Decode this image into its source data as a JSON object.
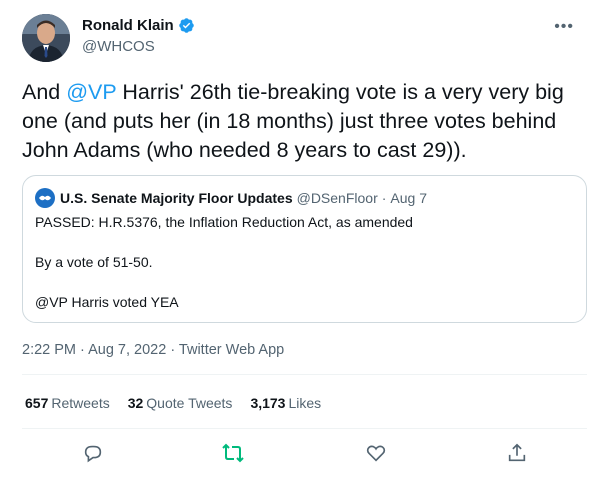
{
  "author": {
    "name": "Ronald Klain",
    "handle": "@WHCOS",
    "verified": true
  },
  "tweet": {
    "text_before": "And ",
    "mention": "@VP",
    "text_after": " Harris' 26th tie-breaking vote is a very very big one (and puts her (in 18 months) just three votes behind John Adams (who needed 8 years to cast 29)).",
    "timestamp": "2:22 PM · Aug 7, 2022 · Twitter Web App"
  },
  "quote": {
    "name": "U.S. Senate Majority Floor Updates",
    "handle": "@DSenFloor",
    "separator": "·",
    "date": "Aug 7",
    "lines": [
      "PASSED: H.R.5376, the Inflation Reduction Act, as amended",
      "By a vote of 51-50.",
      "@VP Harris voted YEA"
    ]
  },
  "stats": {
    "retweets_count": "657",
    "retweets_label": "Retweets",
    "quotes_count": "32",
    "quotes_label": "Quote Tweets",
    "likes_count": "3,173",
    "likes_label": "Likes"
  },
  "colors": {
    "accent": "#1d9bf0",
    "retweet_green": "#00ba7c",
    "secondary_text": "#536471"
  },
  "icons": {
    "more": "more-options-icon",
    "reply": "reply-icon",
    "retweet": "retweet-icon",
    "like": "heart-icon",
    "share": "share-icon"
  }
}
